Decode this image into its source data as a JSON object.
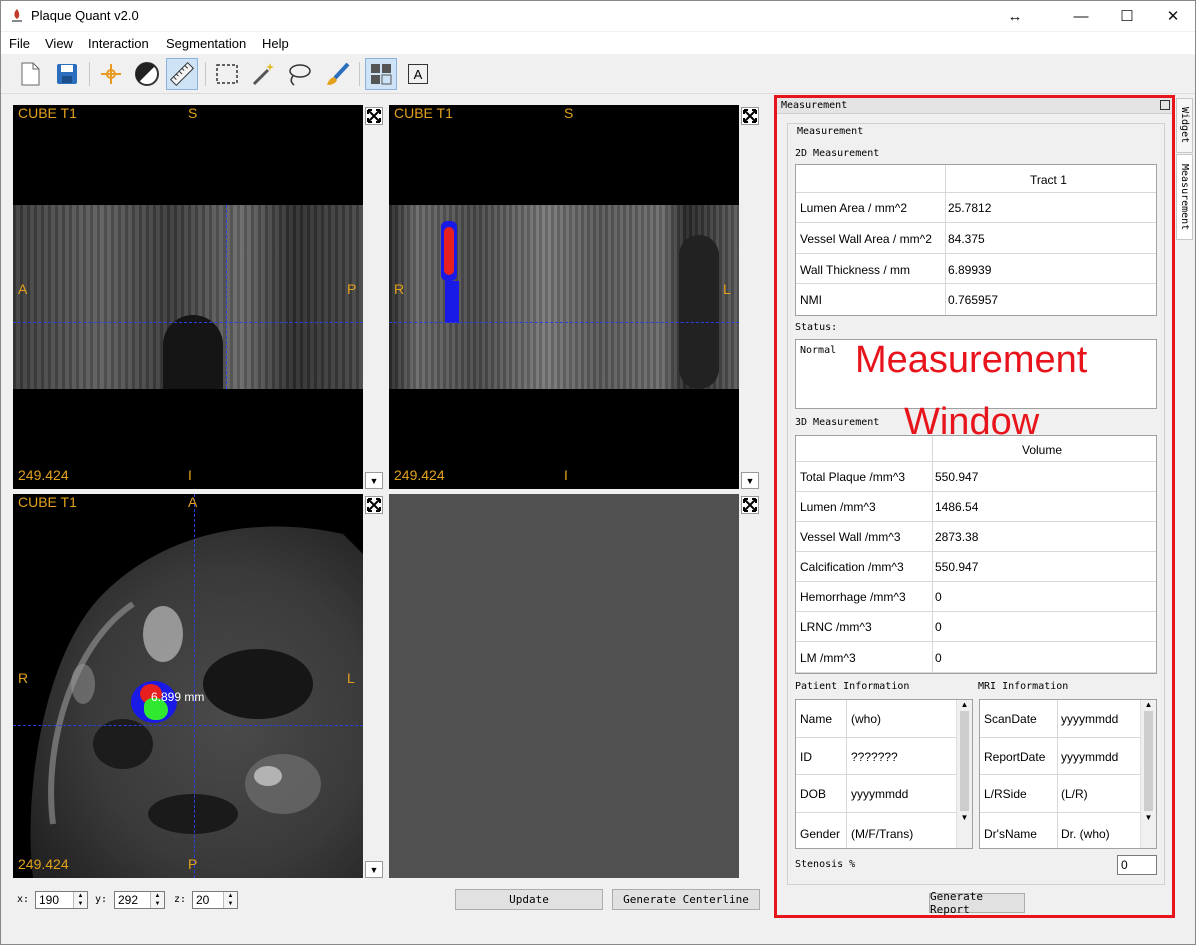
{
  "window": {
    "title": "Plaque Quant v2.0",
    "controls": {
      "resize": "↔",
      "minimize": "—",
      "maximize": "☐",
      "close": "✕"
    }
  },
  "menu": {
    "file": "File",
    "view": "View",
    "interaction": "Interaction",
    "segmentation": "Segmentation",
    "help": "Help"
  },
  "toolbar": {
    "icons": [
      "new-file-icon",
      "save-icon",
      "navigation-icon",
      "contrast-icon",
      "ruler-icon",
      "roi-select-icon",
      "magic-wand-icon",
      "lasso-icon",
      "brush-icon",
      "layout-icon",
      "annotation-icon"
    ],
    "annotation_letter": "A"
  },
  "views": {
    "sagittal": {
      "series": "CUBE T1",
      "top": "S",
      "bottom": "I",
      "left": "A",
      "right": "P",
      "value": "249.424"
    },
    "coronal": {
      "series": "CUBE T1",
      "top": "S",
      "bottom": "I",
      "left": "R",
      "right": "L",
      "value": "249.424"
    },
    "axial": {
      "series": "CUBE T1",
      "top": "A",
      "bottom": "P",
      "left": "R",
      "right": "L",
      "value": "249.424",
      "measure_text": "6.899 mm"
    }
  },
  "coords": {
    "x_label": "x:",
    "x_value": "190",
    "y_label": "y:",
    "y_value": "292",
    "z_label": "z:",
    "z_value": "20"
  },
  "buttons": {
    "update": "Update",
    "generate_centerline": "Generate Centerline",
    "generate_report": "Generate Report"
  },
  "panel": {
    "dock_title": "Measurement",
    "group_title": "Measurement",
    "tabs": {
      "widget": "Widget",
      "measurement": "Measurement"
    },
    "section_2d": "2D Measurement",
    "table_2d": {
      "header": "Tract 1",
      "rows": [
        {
          "label": "Lumen Area / mm^2",
          "value": "25.7812"
        },
        {
          "label": "Vessel Wall Area / mm^2",
          "value": "84.375"
        },
        {
          "label": "Wall Thickness / mm",
          "value": "6.89939"
        },
        {
          "label": "NMI",
          "value": "0.765957"
        }
      ]
    },
    "status_label": "Status:",
    "status_value": "Normal",
    "overlay_line1": "Measurement",
    "overlay_line2": "Window",
    "section_3d": "3D Measurement",
    "table_3d": {
      "header": "Volume",
      "rows": [
        {
          "label": "Total Plaque /mm^3",
          "value": "550.947"
        },
        {
          "label": "Lumen /mm^3",
          "value": "1486.54"
        },
        {
          "label": "Vessel Wall /mm^3",
          "value": "2873.38"
        },
        {
          "label": "Calcification /mm^3",
          "value": "550.947"
        },
        {
          "label": "Hemorrhage /mm^3",
          "value": "0"
        },
        {
          "label": "LRNC /mm^3",
          "value": "0"
        },
        {
          "label": "LM /mm^3",
          "value": "0"
        }
      ]
    },
    "patient_title": "Patient Information",
    "patient": [
      {
        "label": "Name",
        "value": "(who)"
      },
      {
        "label": "ID",
        "value": "???????"
      },
      {
        "label": "DOB",
        "value": "yyyymmdd"
      },
      {
        "label": "Gender",
        "value": "(M/F/Trans)"
      }
    ],
    "mri_title": "MRI Information",
    "mri": [
      {
        "label": "ScanDate",
        "value": "yyyymmdd"
      },
      {
        "label": "ReportDate",
        "value": "yyyymmdd"
      },
      {
        "label": "L/RSide",
        "value": "(L/R)"
      },
      {
        "label": "Dr'sName",
        "value": "Dr. (who)"
      }
    ],
    "stenosis_label": "Stenosis %",
    "stenosis_value": "0"
  },
  "colors": {
    "highlight_border": "#e8141c",
    "overlay_text": "#e8141c",
    "view_label": "#e3a21a",
    "crosshair": "#2d3ee8"
  }
}
